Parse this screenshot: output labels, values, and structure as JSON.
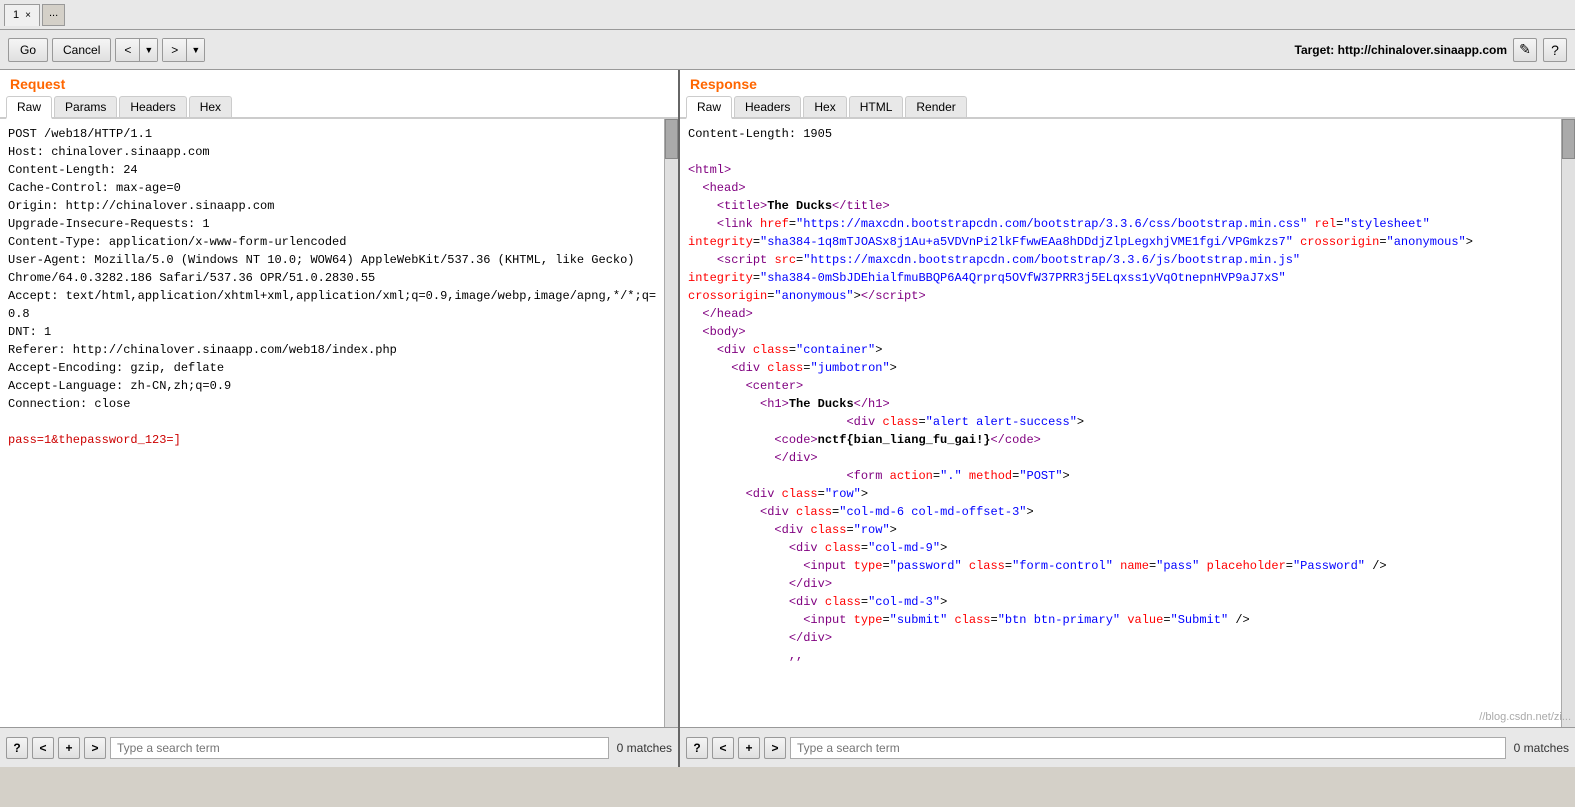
{
  "titlebar": {
    "tab1_label": "1",
    "tab1_close": "×",
    "tab_menu": "..."
  },
  "toolbar": {
    "go_label": "Go",
    "cancel_label": "Cancel",
    "back_label": "< |▼",
    "forward_label": "> |▼",
    "target_prefix": "Target:",
    "target_url": "http://chinalover.sinaapp.com",
    "edit_icon": "✎",
    "help_icon": "?"
  },
  "request": {
    "title": "Request",
    "tabs": [
      "Raw",
      "Params",
      "Headers",
      "Hex"
    ],
    "active_tab": "Raw",
    "content_lines": [
      "POST /web18/HTTP/1.1",
      "Host: chinalover.sinaapp.com",
      "Content-Length: 24",
      "Cache-Control: max-age=0",
      "Origin: http://chinalover.sinaapp.com",
      "Upgrade-Insecure-Requests: 1",
      "Content-Type: application/x-www-form-urlencoded",
      "User-Agent: Mozilla/5.0 (Windows NT 10.0; WOW64) AppleWebKit/537.36 (KHTML, like Gecko)",
      "Chrome/64.0.3282.186 Safari/537.36 OPR/51.0.2830.55",
      "Accept: text/html,application/xhtml+xml,application/xml;q=0.9,image/webp,image/apng,*/*;q=0.8",
      "DNT: 1",
      "Referer: http://chinalover.sinaapp.com/web18/index.php",
      "Accept-Encoding: gzip, deflate",
      "Accept-Language: zh-CN,zh;q=0.9",
      "Connection: close"
    ],
    "body_line": "pass=1&thepassword_123=]",
    "search_placeholder": "Type a search term",
    "matches_label": "0 matches"
  },
  "response": {
    "title": "Response",
    "tabs": [
      "Raw",
      "Headers",
      "Hex",
      "HTML",
      "Render"
    ],
    "active_tab": "Raw",
    "header_line": "Content-Length: 1905",
    "search_placeholder": "Type a search term",
    "matches_label": "0 matches",
    "watermark": "//blog.csdn.net/zi..."
  },
  "search_bars": {
    "help_icon": "?",
    "prev_icon": "<",
    "add_icon": "+",
    "next_icon": ">"
  }
}
